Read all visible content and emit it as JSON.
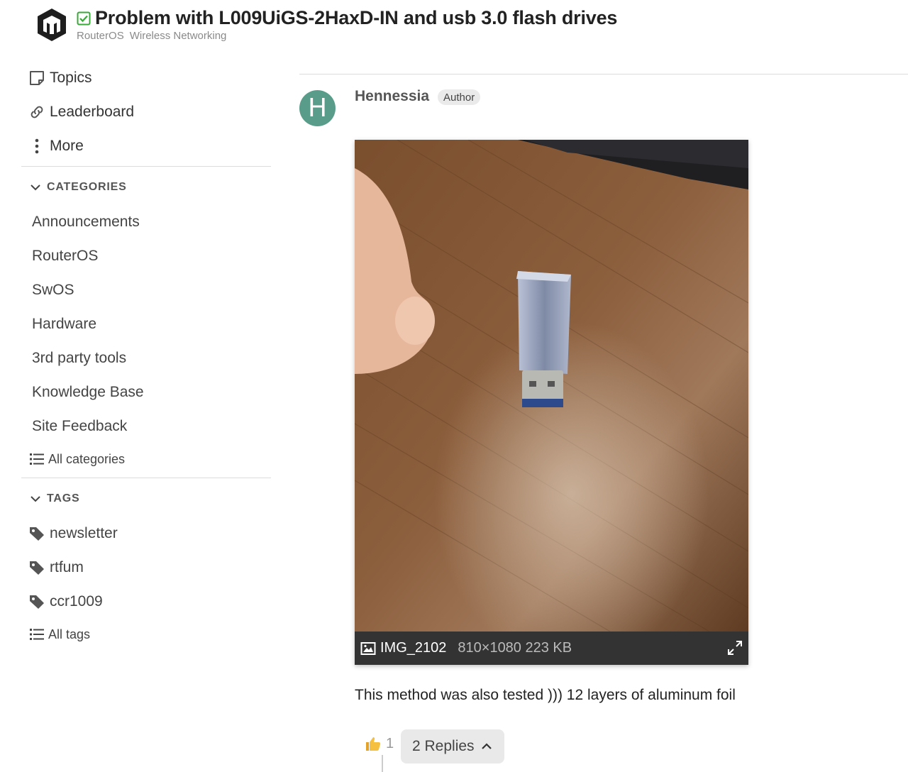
{
  "header": {
    "title": "Problem with L009UiGS-2HaxD-IN and usb 3.0 flash drives",
    "breadcrumbs": [
      "RouterOS",
      "Wireless Networking"
    ],
    "solved_icon": "checkbox-check-icon",
    "logo_icon": "mikrotik-logo"
  },
  "sidebar": {
    "nav": [
      {
        "label": "Topics",
        "icon": "topics-icon"
      },
      {
        "label": "Leaderboard",
        "icon": "link-icon"
      },
      {
        "label": "More",
        "icon": "vertical-ellipsis-icon"
      }
    ],
    "categories_heading": "CATEGORIES",
    "categories": [
      "Announcements",
      "RouterOS",
      "SwOS",
      "Hardware",
      "3rd party tools",
      "Knowledge Base",
      "Site Feedback"
    ],
    "all_categories": "All categories",
    "tags_heading": "TAGS",
    "tags": [
      "newsletter",
      "rtfum",
      "ccr1009"
    ],
    "all_tags": "All tags"
  },
  "post": {
    "avatar_letter": "H",
    "avatar_color": "#5a9c8a",
    "username": "Hennessia",
    "badge": "Author",
    "image": {
      "filename": "IMG_2102",
      "info": "810×1080 223 KB"
    },
    "body": "This method was also tested ))) 12 layers of aluminum foil",
    "like_count": "1",
    "replies_label": "2 Replies"
  }
}
